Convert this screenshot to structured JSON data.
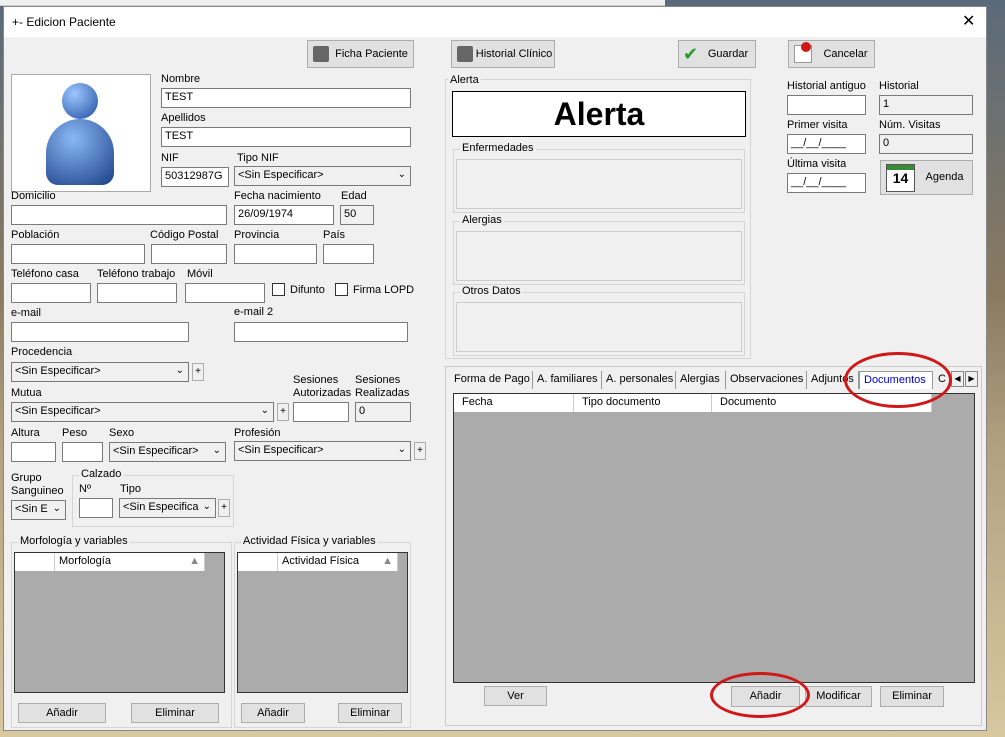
{
  "window": {
    "title": "+- Edicion Paciente",
    "close": "✕"
  },
  "toolbar": {
    "ficha": "Ficha Paciente",
    "historial": "Historial Clínico",
    "guardar": "Guardar",
    "cancelar": "Cancelar"
  },
  "patient": {
    "nombre_label": "Nombre",
    "nombre": "TEST",
    "apellidos_label": "Apellidos",
    "apellidos": "TEST",
    "nif_label": "NIF",
    "nif": "50312987G",
    "tipo_nif_label": "Tipo NIF",
    "tipo_nif": "<Sin Especificar>",
    "domicilio_label": "Domicilio",
    "domicilio": "",
    "fecha_nac_label": "Fecha nacimiento",
    "fecha_nac": "26/09/1974",
    "edad_label": "Edad",
    "edad": "50",
    "poblacion_label": "Población",
    "cp_label": "Código Postal",
    "provincia_label": "Provincia",
    "pais_label": "País",
    "tel_casa_label": "Teléfono casa",
    "tel_trabajo_label": "Teléfono trabajo",
    "movil_label": "Móvil",
    "difunto_label": "Difunto",
    "lopd_label": "Firma LOPD",
    "email_label": "e-mail",
    "email2_label": "e-mail 2",
    "procedencia_label": "Procedencia",
    "procedencia": "<Sin Especificar>",
    "sesiones_aut_label": "Sesiones Autorizadas",
    "sesiones_real_label": "Sesiones Realizadas",
    "sesiones_real": "0",
    "mutua_label": "Mutua",
    "mutua": "<Sin Especificar>",
    "altura_label": "Altura",
    "peso_label": "Peso",
    "sexo_label": "Sexo",
    "sexo": "<Sin Especificar>",
    "profesion_label": "Profesión",
    "profesion": "<Sin Especificar>",
    "grupo_label": "Grupo Sanguineo",
    "grupo": "<Sin E",
    "calzado_label": "Calzado",
    "num_label": "Nº",
    "tipo_label": "Tipo",
    "tipo": "<Sin Especifica"
  },
  "morfologia": {
    "title": "Morfología y variables",
    "col": "Morfología",
    "add": "Añadir",
    "del": "Eliminar"
  },
  "actividad": {
    "title": "Actividad Física y variables",
    "col": "Actividad Física",
    "add": "Añadir",
    "del": "Eliminar"
  },
  "alerta": {
    "group": "Alerta",
    "text": "Alerta",
    "enfermedades": "Enfermedades",
    "alergias": "Alergias",
    "otros": "Otros Datos"
  },
  "historial": {
    "antiguo_label": "Historial antiguo",
    "historial_label": "Historial",
    "historial": "1",
    "primer_label": "Primer visita",
    "primer": "__/__/____",
    "num_visitas_label": "Núm. Visitas",
    "num_visitas": "0",
    "ultima_label": "Última visita",
    "ultima": "__/__/____",
    "agenda": "Agenda",
    "agenda_day": "14"
  },
  "tabs": [
    "Forma de Pago",
    "A. familiares",
    "A. personales",
    "Alergias",
    "Observaciones",
    "Adjuntos",
    "Documentos",
    "C"
  ],
  "docs": {
    "cols": [
      "Fecha",
      "Tipo documento",
      "Documento"
    ],
    "ver": "Ver",
    "anadir": "Añadir",
    "modificar": "Modificar",
    "eliminar": "Eliminar"
  },
  "colors": {
    "highlight": "#d01818",
    "active_tab": "#0000cc"
  }
}
